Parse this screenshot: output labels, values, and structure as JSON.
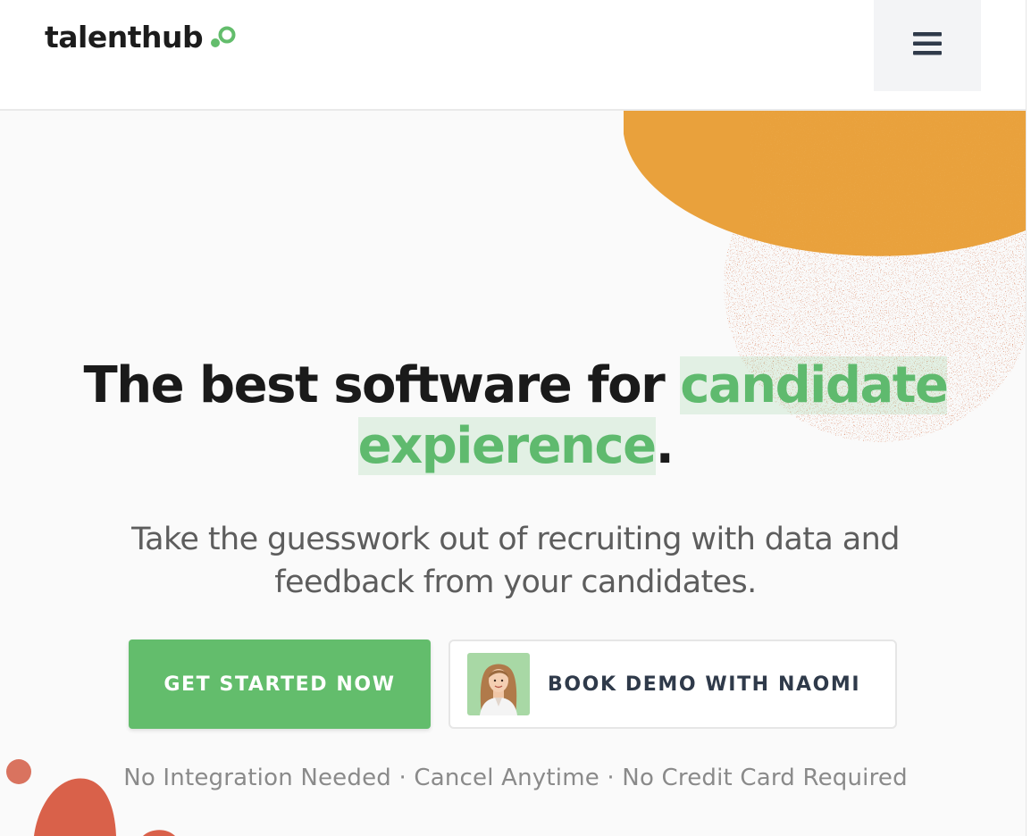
{
  "header": {
    "logo_text": "talenthub",
    "menu_icon": "hamburger-menu-icon"
  },
  "hero": {
    "title_part1": "The best software for ",
    "title_highlight1": "candidate",
    "title_highlight2": "expierence",
    "title_end": ".",
    "subtitle": "Take the guesswork out of recruiting with data and feedback from your candidates."
  },
  "actions": {
    "primary_label": "GET STARTED NOW",
    "demo_label": "BOOK DEMO WITH NAOMI",
    "demo_avatar_icon": "person-avatar"
  },
  "features_line": "No Integration Needed · Cancel Anytime · No Credit Card Required",
  "colors": {
    "brand_green": "#63bd6c",
    "highlight_green": "#5fba6e",
    "accent_orange": "#e9a13c",
    "accent_red": "#d9614a",
    "text_dark": "#1a1a1a"
  }
}
